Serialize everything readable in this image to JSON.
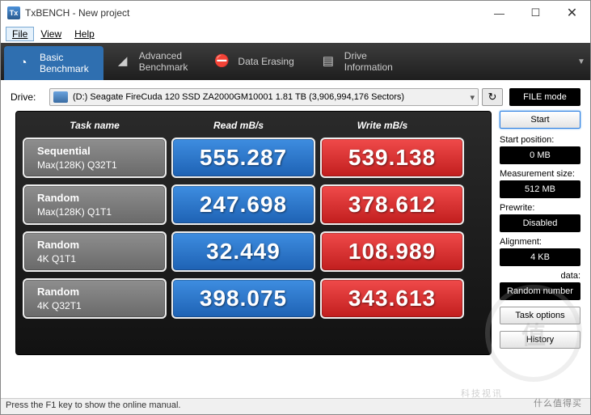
{
  "window": {
    "title": "TxBENCH - New project"
  },
  "menu": {
    "file": "File",
    "view": "View",
    "help": "Help"
  },
  "tabs": {
    "basic": {
      "line1": "Basic",
      "line2": "Benchmark"
    },
    "advanced": {
      "line1": "Advanced",
      "line2": "Benchmark"
    },
    "erasing": {
      "line1": "Data Erasing",
      "line2": ""
    },
    "drive": {
      "line1": "Drive",
      "line2": "Information"
    }
  },
  "drive": {
    "label": "Drive:",
    "selected": "(D:) Seagate FireCuda 120 SSD ZA2000GM10001   1.81 TB (3,906,994,176 Sectors)",
    "refresh_glyph": "↻",
    "filemode": "FILE mode"
  },
  "headers": {
    "task": "Task name",
    "read": "Read mB/s",
    "write": "Write mB/s"
  },
  "rows": [
    {
      "name1": "Sequential",
      "name2": "Max(128K) Q32T1",
      "read": "555.287",
      "write": "539.138"
    },
    {
      "name1": "Random",
      "name2": "Max(128K) Q1T1",
      "read": "247.698",
      "write": "378.612"
    },
    {
      "name1": "Random",
      "name2": "4K Q1T1",
      "read": "32.449",
      "write": "108.989"
    },
    {
      "name1": "Random",
      "name2": "4K Q32T1",
      "read": "398.075",
      "write": "343.613"
    }
  ],
  "side": {
    "start": "Start",
    "startpos_label": "Start position:",
    "startpos_value": "0 MB",
    "msize_label": "Measurement size:",
    "msize_value": "512 MB",
    "prewrite_label": "Prewrite:",
    "prewrite_value": "Disabled",
    "align_label": "Alignment:",
    "align_value": "4 KB",
    "data_label": "data:",
    "data_value": "Random number",
    "taskopt": "Task options",
    "history": "History"
  },
  "status": "Press the F1 key to show the online manual.",
  "watermark": {
    "logo": "值",
    "text1": "什么值得买",
    "text2": "科技视讯"
  },
  "chart_data": {
    "type": "table",
    "title": "TxBENCH Basic Benchmark",
    "columns": [
      "Task name",
      "Read mB/s",
      "Write mB/s"
    ],
    "rows": [
      [
        "Sequential Max(128K) Q32T1",
        555.287,
        539.138
      ],
      [
        "Random Max(128K) Q1T1",
        247.698,
        378.612
      ],
      [
        "Random 4K Q1T1",
        32.449,
        108.989
      ],
      [
        "Random 4K Q32T1",
        398.075,
        343.613
      ]
    ]
  }
}
